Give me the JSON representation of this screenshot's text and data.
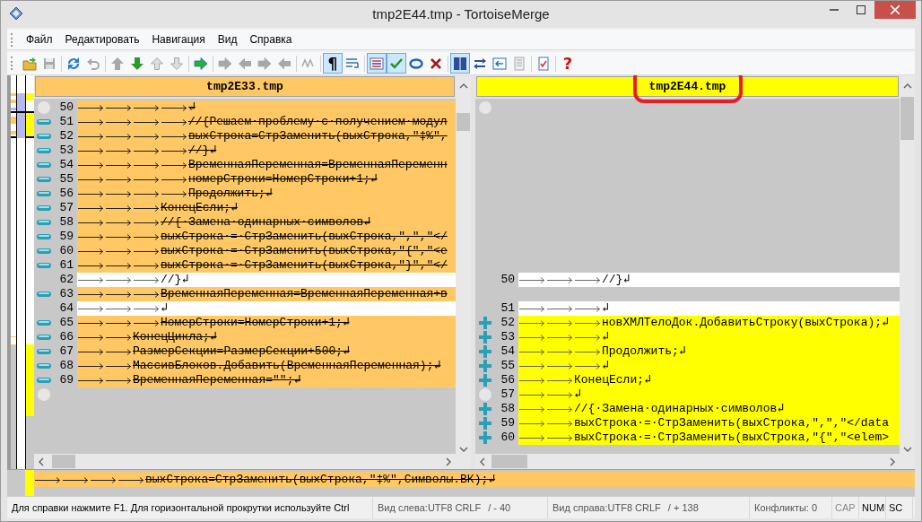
{
  "window": {
    "title": "tmp2E44.tmp - TortoiseMerge"
  },
  "menu": [
    {
      "label": "Файл"
    },
    {
      "label": "Редактировать"
    },
    {
      "label": "Навигация"
    },
    {
      "label": "Вид"
    },
    {
      "label": "Справка"
    }
  ],
  "toolbar": [
    [
      {
        "pressed": false,
        "disabled": false
      },
      {
        "pressed": false,
        "disabled": true
      }
    ],
    [
      {
        "pressed": false,
        "disabled": false
      },
      {
        "pressed": false,
        "disabled": true
      }
    ],
    [
      {
        "pressed": false,
        "disabled": true
      },
      {
        "pressed": false,
        "disabled": false
      },
      {
        "pressed": false,
        "disabled": true
      },
      {
        "pressed": false,
        "disabled": true
      }
    ],
    [
      {
        "pressed": false,
        "disabled": false
      }
    ],
    [
      {
        "pressed": false,
        "disabled": true
      },
      {
        "pressed": false,
        "disabled": true
      },
      {
        "pressed": false,
        "disabled": true
      },
      {
        "pressed": false,
        "disabled": true
      }
    ],
    [
      {
        "pressed": false,
        "disabled": true
      }
    ],
    [
      {
        "glyph": "¶",
        "pressed": true,
        "disabled": false
      },
      {
        "pressed": false,
        "disabled": false
      }
    ],
    [
      {
        "pressed": true,
        "disabled": false
      },
      {
        "pressed": true,
        "disabled": false
      },
      {
        "pressed": false,
        "disabled": false
      },
      {
        "pressed": false,
        "disabled": false
      }
    ],
    [
      {
        "pressed": true,
        "disabled": false
      },
      {
        "pressed": false,
        "disabled": false
      },
      {
        "pressed": false,
        "disabled": false
      },
      {
        "pressed": false,
        "disabled": true
      }
    ],
    [
      {
        "pressed": false,
        "disabled": false
      }
    ],
    [
      {
        "glyph": "?",
        "pressed": false,
        "disabled": false
      }
    ]
  ],
  "left_pane": {
    "kind": "removed",
    "header": "tmp2E33.tmp",
    "rows": [
      {
        "kind": "removed",
        "whitespace": true,
        "number": "50",
        "text": "\t\t\t\t↲"
      },
      {
        "kind": "removed",
        "whitespace": false,
        "number": "51",
        "text": "\t\t\t\t//{Решаем·проблему·с·получением·модул"
      },
      {
        "kind": "removed",
        "whitespace": false,
        "number": "52",
        "text": "\t\t\t\tвыхСтрока=СтрЗаменить(выхСтрока,\"‡%\","
      },
      {
        "kind": "removed",
        "whitespace": false,
        "number": "53",
        "text": "\t\t\t\t//}↲"
      },
      {
        "kind": "removed",
        "whitespace": false,
        "number": "54",
        "text": "\t\t\t\tВременнаяПеременная=ВременнаяПеременн"
      },
      {
        "kind": "removed",
        "whitespace": false,
        "number": "55",
        "text": "\t\t\t\tномерСтроки=НомерСтроки+1;↲"
      },
      {
        "kind": "removed",
        "whitespace": false,
        "number": "56",
        "text": "\t\t\t\tПродолжить;↲"
      },
      {
        "kind": "removed",
        "whitespace": false,
        "number": "57",
        "text": "\t\t\tКонецЕсли;↲"
      },
      {
        "kind": "removed",
        "whitespace": false,
        "number": "58",
        "text": "\t\t\t//{·Замена·одинарных·символов↲"
      },
      {
        "kind": "removed",
        "whitespace": false,
        "number": "59",
        "text": "\t\t\tвыхСтрока·=·СтрЗаменить(выхСтрока,\",\",\"</"
      },
      {
        "kind": "removed",
        "whitespace": false,
        "number": "60",
        "text": "\t\t\tвыхСтрока·=·СтрЗаменить(выхСтрока,\"{\",\"<e"
      },
      {
        "kind": "removed",
        "whitespace": false,
        "number": "61",
        "text": "\t\t\tвыхСтрока·=·СтрЗаменить(выхСтрока,\"}\",\"</"
      },
      {
        "kind": "normal",
        "whitespace": false,
        "number": "62",
        "text": "\t\t\t//}↲"
      },
      {
        "kind": "removed",
        "whitespace": false,
        "number": "63",
        "text": "\t\t\tВременнаяПеременная=ВременнаяПеременная+в"
      },
      {
        "kind": "normal",
        "whitespace": false,
        "number": "64",
        "text": "\t\t\t↲"
      },
      {
        "kind": "removed",
        "whitespace": false,
        "number": "65",
        "text": "\t\t\tНомерСтроки=НомерСтроки+1;↲"
      },
      {
        "kind": "removed",
        "whitespace": false,
        "number": "66",
        "text": "\t\tКонецЦикла;↲"
      },
      {
        "kind": "removed",
        "whitespace": false,
        "number": "67",
        "text": "\t\tРазмерСекции=РазмерСекции+500;↲"
      },
      {
        "kind": "removed",
        "whitespace": false,
        "number": "68",
        "text": "\t\tМассивБлоков.Добавить(ВременнаяПеременная);↲"
      },
      {
        "kind": "removed",
        "whitespace": false,
        "number": "69",
        "text": "\t\tВременнаяПеременная=\"\";↲"
      },
      {
        "kind": "blank",
        "whitespace": true
      }
    ]
  },
  "right_pane": {
    "kind": "added",
    "header": "tmp2E44.tmp",
    "rows": [
      {
        "kind": "blank",
        "whitespace": true
      },
      {
        "kind": "blank",
        "whitespace": false
      },
      {
        "kind": "blank",
        "whitespace": false
      },
      {
        "kind": "blank",
        "whitespace": false
      },
      {
        "kind": "blank",
        "whitespace": false
      },
      {
        "kind": "blank",
        "whitespace": false
      },
      {
        "kind": "blank",
        "whitespace": false
      },
      {
        "kind": "blank",
        "whitespace": false
      },
      {
        "kind": "blank",
        "whitespace": false
      },
      {
        "kind": "blank",
        "whitespace": false
      },
      {
        "kind": "blank",
        "whitespace": false
      },
      {
        "kind": "blank",
        "whitespace": false
      },
      {
        "kind": "normal",
        "whitespace": false,
        "number": "50",
        "text": "\t\t\t//}↲"
      },
      {
        "kind": "blank",
        "whitespace": false
      },
      {
        "kind": "normal",
        "whitespace": false,
        "number": "51",
        "text": "\t\t\t↲"
      },
      {
        "kind": "added",
        "whitespace": false,
        "number": "52",
        "text": "\t\t\tновХМЛТелоДок.ДобавитьСтроку(выхСтрока);↲"
      },
      {
        "kind": "added",
        "whitespace": false,
        "number": "53",
        "text": "\t\t\t↲"
      },
      {
        "kind": "added",
        "whitespace": false,
        "number": "54",
        "text": "\t\t\tПродолжить;↲"
      },
      {
        "kind": "added",
        "whitespace": false,
        "number": "55",
        "text": "\t\t\t↲"
      },
      {
        "kind": "added",
        "whitespace": false,
        "number": "56",
        "text": "\t\tКонецЕсли;↲"
      },
      {
        "kind": "added",
        "whitespace": true,
        "number": "57",
        "text": "\t\t↲"
      },
      {
        "kind": "added",
        "whitespace": false,
        "number": "58",
        "text": "\t\t//{·Замена·одинарных·символов↲"
      },
      {
        "kind": "added",
        "whitespace": false,
        "number": "59",
        "text": "\t\tвыхСтрока·=·СтрЗаменить(выхСтрока,\",\",\"</data"
      },
      {
        "kind": "added",
        "whitespace": false,
        "number": "60",
        "text": "\t\tвыхСтрока·=·СтрЗаменить(выхСтрока,\"{\",\"<elem>"
      }
    ]
  },
  "bottom_pane": {
    "rows": [
      {
        "kind": "removed",
        "text": "\t\t\t\tвыхСтрока=СтрЗаменить(выхСтрока,\"‡%\",Символы.ВК);↲"
      }
    ]
  },
  "status_bar": {
    "message": "Для справки нажмите F1. Для горизонтальной прокрутки используйте Ctrl",
    "left_view": "Вид слева:UTF8 CRLF",
    "left_count": "/ - 40",
    "right_view": "Вид справа:UTF8 CRLF",
    "right_count": "/ + 138",
    "conflicts": "Конфликты: 0",
    "indicators": [
      {
        "label": "CAP",
        "on": false
      },
      {
        "label": "NUM",
        "on": true
      },
      {
        "label": "SC",
        "on": true
      }
    ]
  }
}
